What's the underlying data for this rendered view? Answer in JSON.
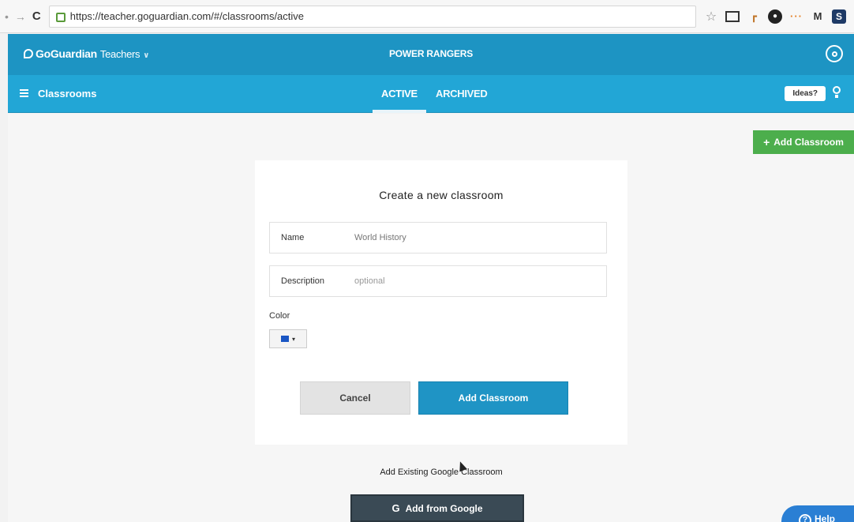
{
  "browser": {
    "url": "https://teacher.goguardian.com/#/classrooms/active"
  },
  "header": {
    "brand": "GoGuardian",
    "brand_sub": "Teachers",
    "org_title": "POWER RANGERS"
  },
  "subnav": {
    "section_title": "Classrooms",
    "tabs": [
      {
        "label": "ACTIVE",
        "active": true
      },
      {
        "label": "ARCHIVED",
        "active": false
      }
    ],
    "ideas_label": "Ideas?"
  },
  "toolbar": {
    "add_classroom_label": "Add Classroom"
  },
  "form": {
    "title": "Create a new classroom",
    "name_label": "Name",
    "name_value": "World History",
    "description_label": "Description",
    "description_placeholder": "optional",
    "color_label": "Color",
    "selected_color": "#1a56c4",
    "cancel_label": "Cancel",
    "submit_label": "Add Classroom"
  },
  "google": {
    "section_label": "Add Existing Google Classroom",
    "button_label": "Add from Google"
  },
  "help": {
    "label": "Help"
  }
}
